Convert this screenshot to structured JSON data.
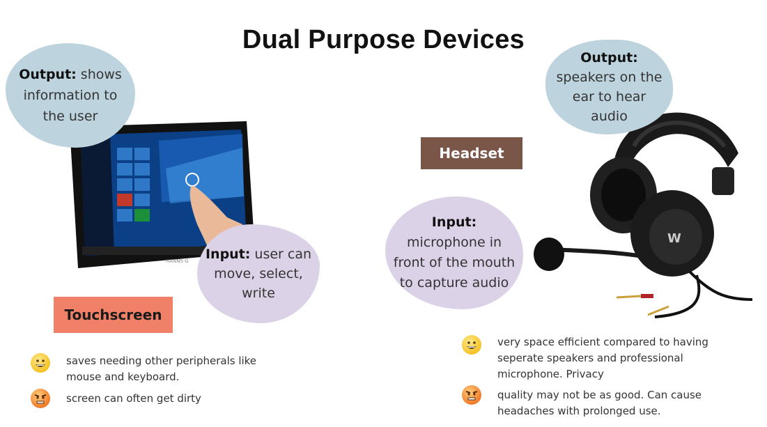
{
  "title": "Dual Purpose Devices",
  "touchscreen": {
    "label": "Touchscreen",
    "output": {
      "heading": "Output:",
      "lines": [
        " shows",
        "information to",
        "the user"
      ]
    },
    "input": {
      "heading": "Input:",
      "lines": [
        " user can",
        "move, select,",
        "write"
      ]
    },
    "pros": [
      "saves needing other peripherals like",
      "mouse and keyboard."
    ],
    "cons": [
      "screen can often get dirty"
    ]
  },
  "headset": {
    "label": "Headset",
    "output": {
      "heading": "Output:",
      "lines": [
        "speakers on the",
        "ear to hear",
        "audio"
      ]
    },
    "input": {
      "heading": "Input:",
      "lines": [
        "microphone in",
        "front of the mouth",
        "to capture audio"
      ]
    },
    "pros": [
      "very space efficient compared to having",
      "seperate speakers and professional",
      "microphone. Privacy"
    ],
    "cons": [
      "quality may not be as good. Can cause",
      "headaches with prolonged use."
    ]
  },
  "colors": {
    "blue_blob": "#bdd3de",
    "lilac_blob": "#dcd2e8",
    "headset_label": "#7a5648",
    "touchscreen_label": "#f08068"
  },
  "icons": {
    "happy": "grinning-face-icon",
    "angry": "angry-face-icon"
  }
}
